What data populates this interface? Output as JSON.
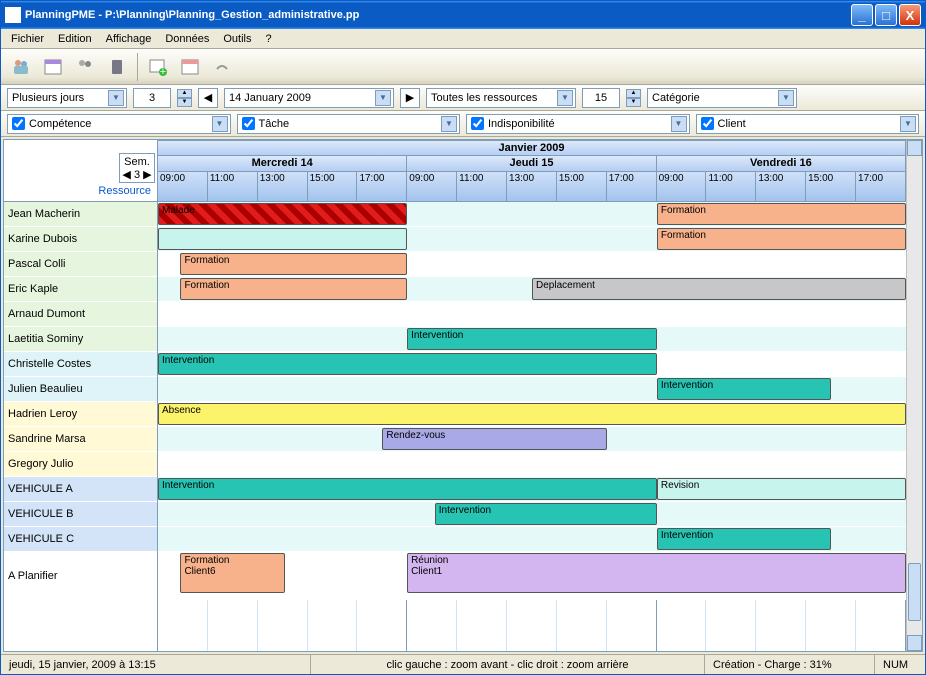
{
  "window": {
    "title": "PlanningPME - P:\\Planning\\Planning_Gestion_administrative.pp"
  },
  "menu": [
    "Fichier",
    "Edition",
    "Affichage",
    "Données",
    "Outils",
    "?"
  ],
  "toolbar1": {
    "view_mode": "Plusieurs jours",
    "day_count": "3",
    "date": "14  January  2009",
    "resources": "Toutes les ressources",
    "res_count": "15",
    "category": "Catégorie"
  },
  "filters": {
    "competence": "Compétence",
    "tache": "Tâche",
    "indispo": "Indisponibilité",
    "client": "Client"
  },
  "calendar": {
    "month": "Janvier 2009",
    "sem_label": "Sem.",
    "week": "3",
    "resource_header": "Ressource",
    "days": [
      "Mercredi 14",
      "Jeudi 15",
      "Vendredi 16"
    ],
    "hours": [
      "09:00",
      "11:00",
      "13:00",
      "15:00",
      "17:00"
    ]
  },
  "resources": [
    {
      "name": "Jean Macherin",
      "bg": "#e6f5dd"
    },
    {
      "name": "Karine Dubois",
      "bg": "#e6f5dd"
    },
    {
      "name": "Pascal Colli",
      "bg": "#e6f5dd"
    },
    {
      "name": "Eric Kaple",
      "bg": "#e6f5dd"
    },
    {
      "name": "Arnaud Dumont",
      "bg": "#e6f5dd"
    },
    {
      "name": "Laetitia Sominy",
      "bg": "#e6f5dd"
    },
    {
      "name": "Christelle Costes",
      "bg": "#dff4f8"
    },
    {
      "name": "Julien Beaulieu",
      "bg": "#dff4f8"
    },
    {
      "name": "Hadrien Leroy",
      "bg": "#fff9d6"
    },
    {
      "name": "Sandrine Marsa",
      "bg": "#fff9d6"
    },
    {
      "name": "Gregory Julio",
      "bg": "#fff9d6"
    },
    {
      "name": "VEHICULE A",
      "bg": "#d3e4f8"
    },
    {
      "name": "VEHICULE B",
      "bg": "#d3e4f8"
    },
    {
      "name": "VEHICULE C",
      "bg": "#d3e4f8"
    },
    {
      "name": "A Planifier",
      "bg": "#ffffff",
      "tall": true
    }
  ],
  "tasks": [
    {
      "row": 0,
      "label": "Malade",
      "start": 0,
      "end": 33.3,
      "bg": "#e21b1b",
      "striped": true
    },
    {
      "row": 0,
      "label": "Formation",
      "start": 66.7,
      "end": 100,
      "bg": "#f7b18b"
    },
    {
      "row": 1,
      "label": "",
      "start": 0,
      "end": 33.3,
      "bg": "#c8f4ee"
    },
    {
      "row": 1,
      "label": "Formation",
      "start": 66.7,
      "end": 100,
      "bg": "#f7b18b"
    },
    {
      "row": 2,
      "label": "Formation",
      "start": 3,
      "end": 33.3,
      "bg": "#f7b18b"
    },
    {
      "row": 3,
      "label": "Formation",
      "start": 3,
      "end": 33.3,
      "bg": "#f7b18b"
    },
    {
      "row": 3,
      "label": "Deplacement",
      "start": 50,
      "end": 100,
      "bg": "#c7c7c9"
    },
    {
      "row": 5,
      "label": "Intervention",
      "start": 33.3,
      "end": 66.7,
      "bg": "#27c3b3"
    },
    {
      "row": 6,
      "label": "Intervention",
      "start": 0,
      "end": 66.7,
      "bg": "#27c3b3"
    },
    {
      "row": 7,
      "label": "Intervention",
      "start": 66.7,
      "end": 90,
      "bg": "#27c3b3"
    },
    {
      "row": 8,
      "label": "Absence",
      "start": 0,
      "end": 100,
      "bg": "#fbf36a"
    },
    {
      "row": 9,
      "label": "Rendez-vous",
      "start": 30,
      "end": 60,
      "bg": "#a9a9e8"
    },
    {
      "row": 11,
      "label": "Intervention",
      "start": 0,
      "end": 66.7,
      "bg": "#27c3b3"
    },
    {
      "row": 11,
      "label": "Revision",
      "start": 66.7,
      "end": 100,
      "bg": "#c8f4ee"
    },
    {
      "row": 12,
      "label": "Intervention",
      "start": 37,
      "end": 66.7,
      "bg": "#27c3b3"
    },
    {
      "row": 13,
      "label": "Intervention",
      "start": 66.7,
      "end": 90,
      "bg": "#27c3b3"
    },
    {
      "row": 14,
      "label": "Formation\nClient6",
      "start": 3,
      "end": 17,
      "bg": "#f7b18b",
      "tall": true
    },
    {
      "row": 14,
      "label": "Réunion\nClient1",
      "start": 33.3,
      "end": 100,
      "bg": "#d3b5ef",
      "tall": true
    }
  ],
  "row_bg": [
    "#e6f9f9",
    "#e6f9f9",
    "#ffffff",
    "#e6f9f9",
    "#ffffff",
    "#e6f9f9",
    "#ffffff",
    "#e6f9f9",
    "#ffffff",
    "#e6f9f9",
    "#ffffff",
    "#e6f9f9",
    "#e6f9f9",
    "#e6f9f9",
    "#ffffff"
  ],
  "status": {
    "datetime": "jeudi, 15 janvier, 2009 à 13:15",
    "zoom": "clic gauche : zoom avant - clic droit : zoom arrière",
    "charge": "Création - Charge : 31%",
    "num": "NUM"
  }
}
